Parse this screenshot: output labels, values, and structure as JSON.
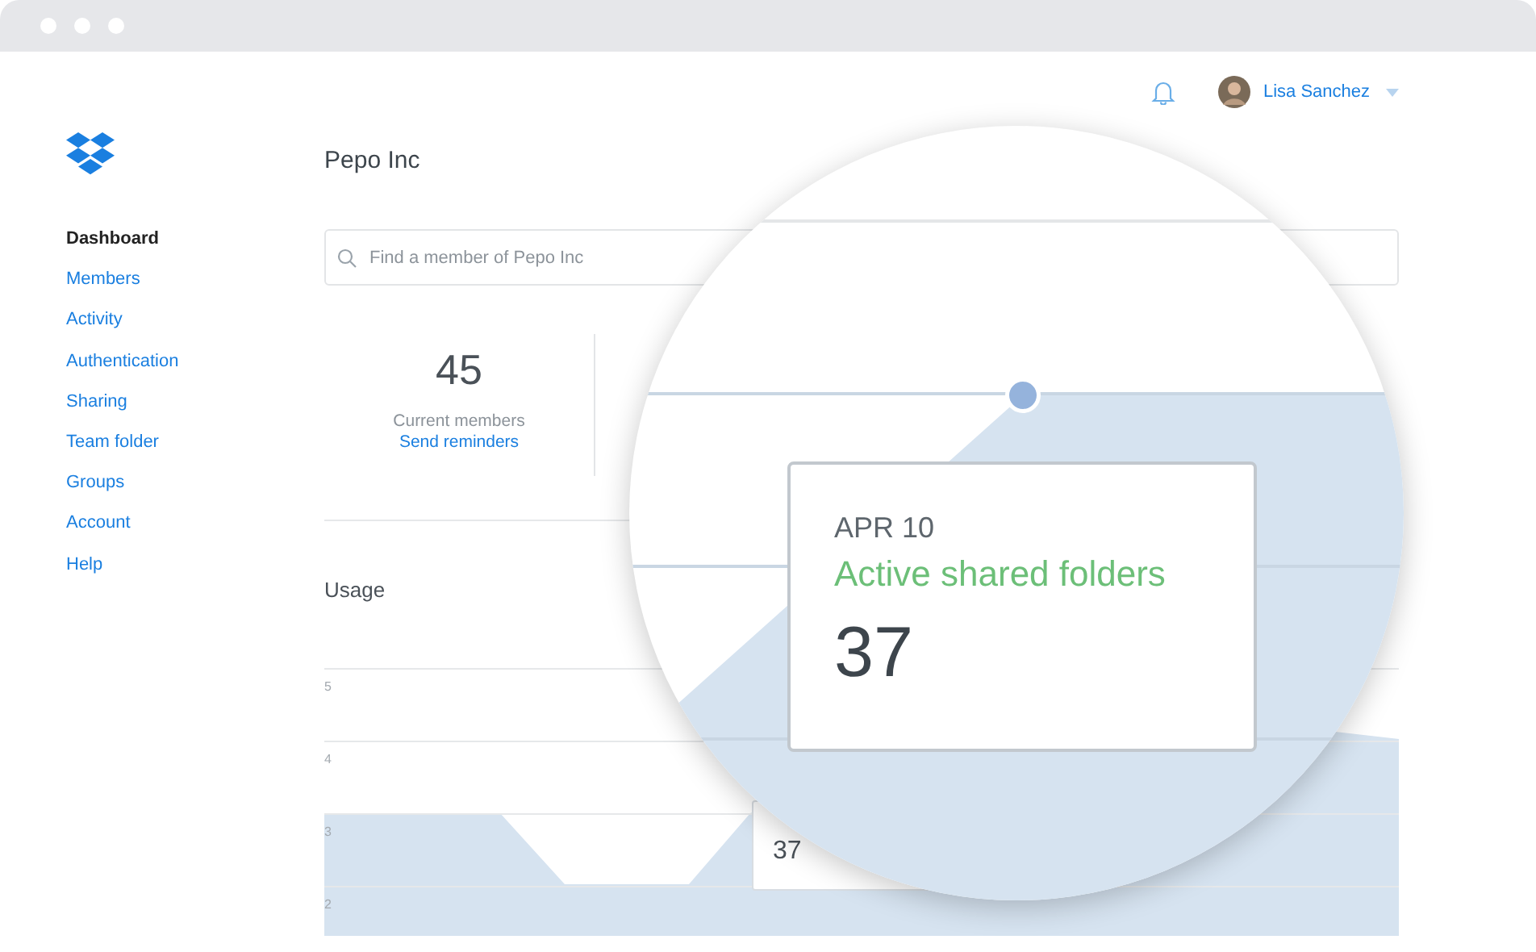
{
  "header": {
    "user_name": "Lisa Sanchez"
  },
  "sidebar": {
    "items": [
      {
        "label": "Dashboard",
        "selected": true
      },
      {
        "label": "Members",
        "selected": false
      },
      {
        "label": "Activity",
        "selected": false
      },
      {
        "label": "Authentication",
        "selected": false
      },
      {
        "label": "Sharing",
        "selected": false
      },
      {
        "label": "Team folder",
        "selected": false
      },
      {
        "label": "Groups",
        "selected": false
      },
      {
        "label": "Account",
        "selected": false
      },
      {
        "label": "Help",
        "selected": false
      }
    ]
  },
  "page_title": "Pepo Inc",
  "search": {
    "placeholder": "Find a member of Pepo Inc"
  },
  "stats": [
    {
      "value": "45",
      "label": "Current members",
      "link": "Send reminders"
    }
  ],
  "usage": {
    "title": "Usage",
    "yticks": [
      "5",
      "4",
      "3",
      "2"
    ],
    "tooltip_value": "37"
  },
  "magnifier": {
    "tooltip": {
      "date": "APR 10",
      "series": "Active shared folders",
      "value": "37"
    }
  }
}
